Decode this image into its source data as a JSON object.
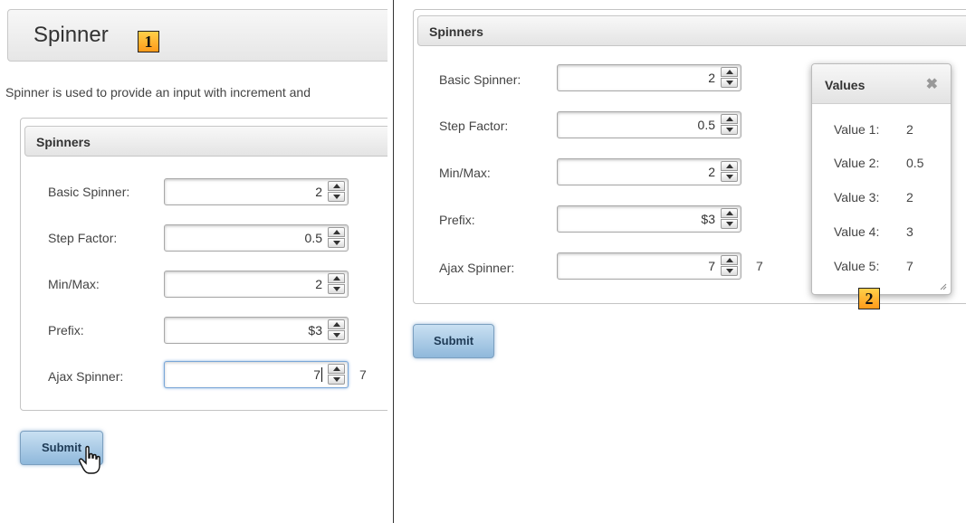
{
  "left": {
    "title": "Spinner",
    "marker": "1",
    "description": "Spinner is used to provide an input with increment and",
    "legend": "Spinners",
    "rows": [
      {
        "label": "Basic Spinner:",
        "value": "2"
      },
      {
        "label": "Step Factor:",
        "value": "0.5"
      },
      {
        "label": "Min/Max:",
        "value": "2"
      },
      {
        "label": "Prefix:",
        "value": "$3"
      },
      {
        "label": "Ajax Spinner:",
        "value": "7"
      }
    ],
    "ajax_output": "7",
    "submit": "Submit"
  },
  "right": {
    "legend": "Spinners",
    "rows": [
      {
        "label": "Basic Spinner:",
        "value": "2"
      },
      {
        "label": "Step Factor:",
        "value": "0.5"
      },
      {
        "label": "Min/Max:",
        "value": "2"
      },
      {
        "label": "Prefix:",
        "value": "$3"
      },
      {
        "label": "Ajax Spinner:",
        "value": "7"
      }
    ],
    "ajax_output": "7",
    "submit": "Submit",
    "dialog": {
      "title": "Values",
      "close": "✖",
      "rows": [
        {
          "label": "Value 1:",
          "value": "2"
        },
        {
          "label": "Value 2:",
          "value": "0.5"
        },
        {
          "label": "Value 3:",
          "value": "2"
        },
        {
          "label": "Value 4:",
          "value": "3"
        },
        {
          "label": "Value 5:",
          "value": "7"
        }
      ],
      "marker": "2"
    }
  },
  "icons": {
    "spinner_up": "triangle-up",
    "spinner_down": "triangle-down",
    "dialog_close": "close",
    "cursor": "hand-pointer",
    "resize": "resize-grip"
  },
  "colors": {
    "submit_gradient_top": "#c9e0f2",
    "submit_gradient_bottom": "#8fb8db",
    "marker_fill": "#ffb02e"
  }
}
